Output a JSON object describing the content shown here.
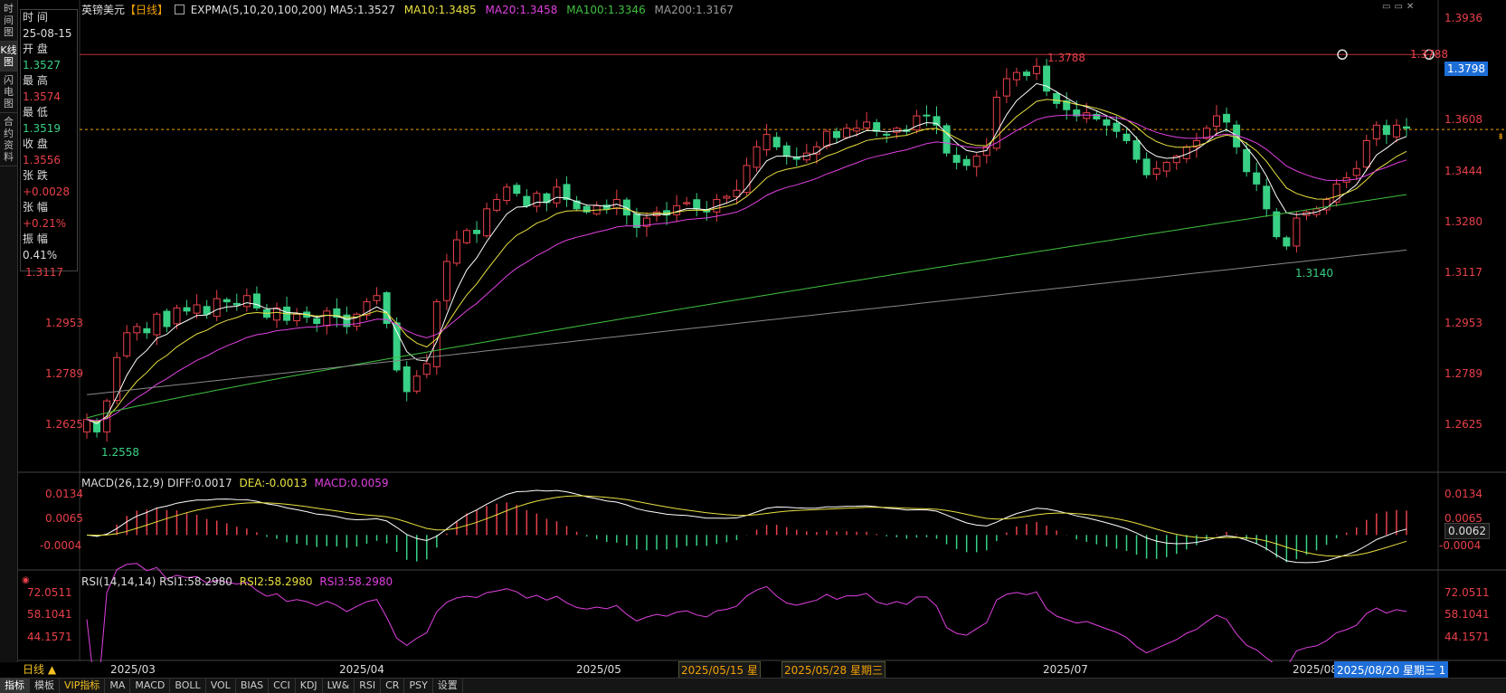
{
  "side_tabs": [
    "时间图",
    "K线图",
    "闪电图",
    "合约资料"
  ],
  "header": {
    "symbol": "英镑美元",
    "period": "【日线】",
    "indicator": "EXPMA(5,10,20,100,200)",
    "ma5": "MA5:1.3527",
    "ma10": "MA10:1.3485",
    "ma20": "MA20:1.3458",
    "ma100": "MA100:1.3346",
    "ma200": "MA200:1.3167"
  },
  "info_panel": {
    "time_label": "时 间",
    "time_value": "25-08-15",
    "open_label": "开 盘",
    "open_value": "1.3527",
    "high_label": "最 高",
    "high_value": "1.3574",
    "low_label": "最 低",
    "low_value": "1.3519",
    "close_label": "收 盘",
    "close_value": "1.3556",
    "change_label": "张 跌",
    "change_value": "+0.0028",
    "pct_label": "张 幅",
    "pct_value": "+0.21%",
    "amp_label": "振 幅",
    "amp_value": "0.41%"
  },
  "main_axis_ticks": [
    "1.3936",
    "1.3608",
    "1.3444",
    "1.3280",
    "1.3117",
    "1.2953",
    "1.2789",
    "1.2625"
  ],
  "left_axis_ticks": [
    "1.3117",
    "1.2953",
    "1.2789",
    "1.2625"
  ],
  "annotations": {
    "high_mark": "1.3788",
    "high_mark_right": "1.3788",
    "low_mark_1": "1.2558",
    "low_mark_2": "1.3140",
    "hline_tag": "1.3798"
  },
  "macd": {
    "title": "MACD(26,12,9)",
    "diff": "DIFF:0.0017",
    "dea": "DEA:-0.0013",
    "macd": "MACD:0.0059",
    "ticks": [
      "0.0134",
      "0.0065",
      "-0.0004"
    ],
    "tag": "0.0062"
  },
  "rsi": {
    "title": "RSI(14,14,14)",
    "rsi1": "RSI1:58.2980",
    "rsi2": "RSI2:58.2980",
    "rsi3": "RSI3:58.2980",
    "ticks": [
      "72.0511",
      "58.1041",
      "44.1571"
    ]
  },
  "x_axis": {
    "labels": [
      "2025/03",
      "2025/04",
      "2025/05",
      "2025/07",
      "2025/08"
    ],
    "cursor1": "2025/05/15 星",
    "cursor2": "2025/05/28 星期三",
    "cursor3": "2025/08/20 星期三 1"
  },
  "bottom_tabs": [
    "指标",
    "模板",
    "VIP指标",
    "MA",
    "MACD",
    "BOLL",
    "VOL",
    "BIAS",
    "CCI",
    "KDJ",
    "LW&",
    "RSI",
    "CR",
    "PSY",
    "设置"
  ],
  "period_button": "日线 ▲",
  "colors": {
    "up": "#e8404a",
    "down": "#38d085",
    "ma5": "#ffffff",
    "ma10": "#e8e040",
    "ma20": "#e040e0",
    "ma100": "#40c040",
    "ma200": "#888888"
  },
  "chart_data": {
    "type": "candlestick",
    "ylim": [
      1.25,
      1.4
    ],
    "closes": [
      1.262,
      1.258,
      1.268,
      1.282,
      1.29,
      1.292,
      1.29,
      1.296,
      1.292,
      1.298,
      1.297,
      1.299,
      1.296,
      1.301,
      1.3,
      1.299,
      1.302,
      1.298,
      1.295,
      1.298,
      1.294,
      1.296,
      1.295,
      1.293,
      1.297,
      1.295,
      1.292,
      1.296,
      1.3,
      1.302,
      1.293,
      1.278,
      1.271,
      1.276,
      1.28,
      1.3,
      1.313,
      1.32,
      1.323,
      1.322,
      1.33,
      1.333,
      1.337,
      1.335,
      1.331,
      1.335,
      1.332,
      1.337,
      1.333,
      1.33,
      1.329,
      1.331,
      1.33,
      1.333,
      1.328,
      1.324,
      1.327,
      1.329,
      1.328,
      1.331,
      1.332,
      1.33,
      1.329,
      1.333,
      1.334,
      1.336,
      1.344,
      1.35,
      1.354,
      1.35,
      1.347,
      1.346,
      1.348,
      1.35,
      1.355,
      1.353,
      1.356,
      1.356,
      1.358,
      1.355,
      1.354,
      1.356,
      1.355,
      1.36,
      1.36,
      1.357,
      1.348,
      1.345,
      1.344,
      1.347,
      1.35,
      1.366,
      1.372,
      1.374,
      1.373,
      1.376,
      1.368,
      1.364,
      1.362,
      1.36,
      1.361,
      1.359,
      1.357,
      1.355,
      1.352,
      1.346,
      1.341,
      1.343,
      1.345,
      1.347,
      1.35,
      1.352,
      1.356,
      1.36,
      1.358,
      1.35,
      1.342,
      1.338,
      1.33,
      1.321,
      1.318,
      1.327,
      1.329,
      1.33,
      1.333,
      1.338,
      1.34,
      1.343,
      1.352,
      1.357,
      1.354,
      1.357,
      1.356
    ]
  }
}
